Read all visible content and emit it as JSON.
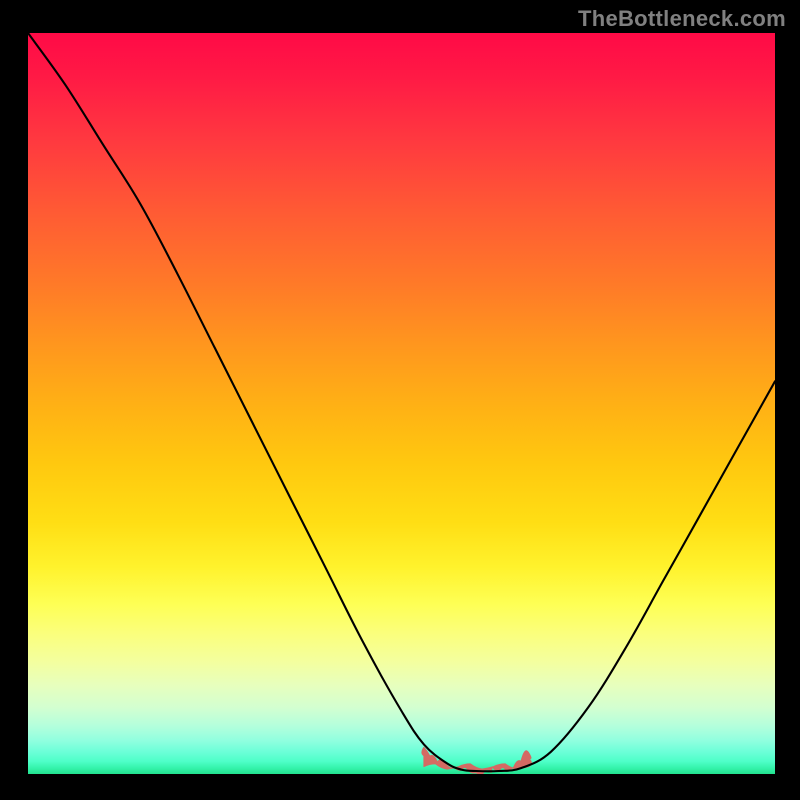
{
  "watermark": "TheBottleneck.com",
  "chart_data": {
    "type": "line",
    "title": "",
    "xlabel": "",
    "ylabel": "",
    "x_range": [
      0,
      100
    ],
    "y_range": [
      0,
      100
    ],
    "gradient_direction": "vertical",
    "gradient_stops": [
      {
        "pos": 0,
        "color": "#ff0a46"
      },
      {
        "pos": 50,
        "color": "#ffb015"
      },
      {
        "pos": 80,
        "color": "#fbff7c"
      },
      {
        "pos": 95,
        "color": "#90ffdf"
      },
      {
        "pos": 100,
        "color": "#22e18f"
      }
    ],
    "series": [
      {
        "name": "bottleneck-curve",
        "x": [
          0,
          5,
          10,
          15,
          20,
          25,
          30,
          35,
          40,
          45,
          50,
          53,
          56,
          58,
          60,
          63,
          66,
          70,
          75,
          80,
          85,
          90,
          95,
          100
        ],
        "y": [
          100,
          93,
          85,
          77,
          67.5,
          57.5,
          47.5,
          37.5,
          27.5,
          17.5,
          8.5,
          4,
          1.5,
          0.6,
          0.4,
          0.4,
          0.8,
          3,
          9,
          17,
          26,
          35,
          44,
          53
        ]
      }
    ],
    "highlight_band": {
      "name": "optimal-zone",
      "color": "#d46a63",
      "x_start": 53,
      "x_end": 67,
      "points": [
        {
          "x": 53.0,
          "y": 3.6
        },
        {
          "x": 53.8,
          "y": 2.4
        },
        {
          "x": 54.8,
          "y": 1.6
        },
        {
          "x": 56.0,
          "y": 1.3
        },
        {
          "x": 57.0,
          "y": 0.9
        },
        {
          "x": 58.0,
          "y": 0.5
        },
        {
          "x": 59.0,
          "y": 0.4
        },
        {
          "x": 60.0,
          "y": 0.2
        },
        {
          "x": 61.0,
          "y": 0.2
        },
        {
          "x": 62.0,
          "y": 0.2
        },
        {
          "x": 62.3,
          "y": 0.8
        },
        {
          "x": 63.0,
          "y": 0.3
        },
        {
          "x": 64.0,
          "y": 0.5
        },
        {
          "x": 65.0,
          "y": 0.9
        },
        {
          "x": 66.0,
          "y": 1.7
        },
        {
          "x": 67.0,
          "y": 2.9
        }
      ]
    },
    "notes": "Values are estimated from pixel positions; axes are unlabeled in the source image. y=0 corresponds to the bottom edge, y=100 to the top edge; x=0 left edge, x=100 right edge."
  }
}
